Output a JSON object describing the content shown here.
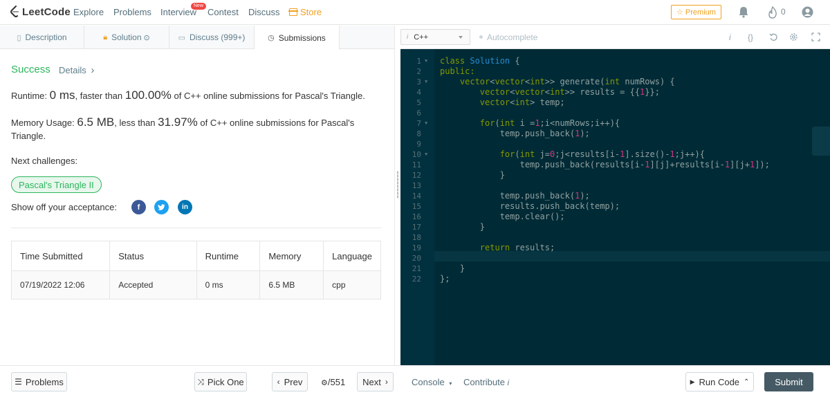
{
  "nav": {
    "logo": "LeetCode",
    "items": [
      "Explore",
      "Problems",
      "Interview",
      "Contest",
      "Discuss",
      "Store"
    ],
    "new_badge": "New",
    "premium": "Premium",
    "fire_count": "0"
  },
  "tabs": [
    "Description",
    "Solution",
    "Discuss (999+)",
    "Submissions"
  ],
  "result": {
    "status": "Success",
    "details": "Details",
    "details_chevron": "›",
    "runtime_label": "Runtime: ",
    "runtime_value": "0 ms",
    "runtime_mid": ", faster than ",
    "runtime_pct": "100.00%",
    "runtime_tail": " of C++ online submissions for Pascal's Triangle.",
    "memory_label": "Memory Usage: ",
    "memory_value": "6.5 MB",
    "memory_mid": ", less than ",
    "memory_pct": "31.97%",
    "memory_tail1": " of C++ online submissions for Pascal's",
    "memory_tail2": "Triangle.",
    "next_label": "Next challenges:",
    "next_challenge": "Pascal's Triangle II",
    "share_label": "Show off your acceptance:"
  },
  "table": {
    "headers": [
      "Time Submitted",
      "Status",
      "Runtime",
      "Memory",
      "Language"
    ],
    "row": [
      "07/19/2022 12:06",
      "Accepted",
      "0 ms",
      "6.5 MB",
      "cpp"
    ]
  },
  "editor": {
    "language": "C++",
    "autocomplete": "Autocomplete"
  },
  "bottom": {
    "problems": "Problems",
    "pick_one": "Pick One",
    "prev": "Prev",
    "page": "/551",
    "next": "Next",
    "console": "Console",
    "contribute": "Contribute",
    "run_code": "Run Code",
    "submit": "Submit"
  },
  "colors": {
    "accent_green": "#2db55d",
    "store_orange": "#f0a020",
    "editor_bg": "#002b36"
  }
}
